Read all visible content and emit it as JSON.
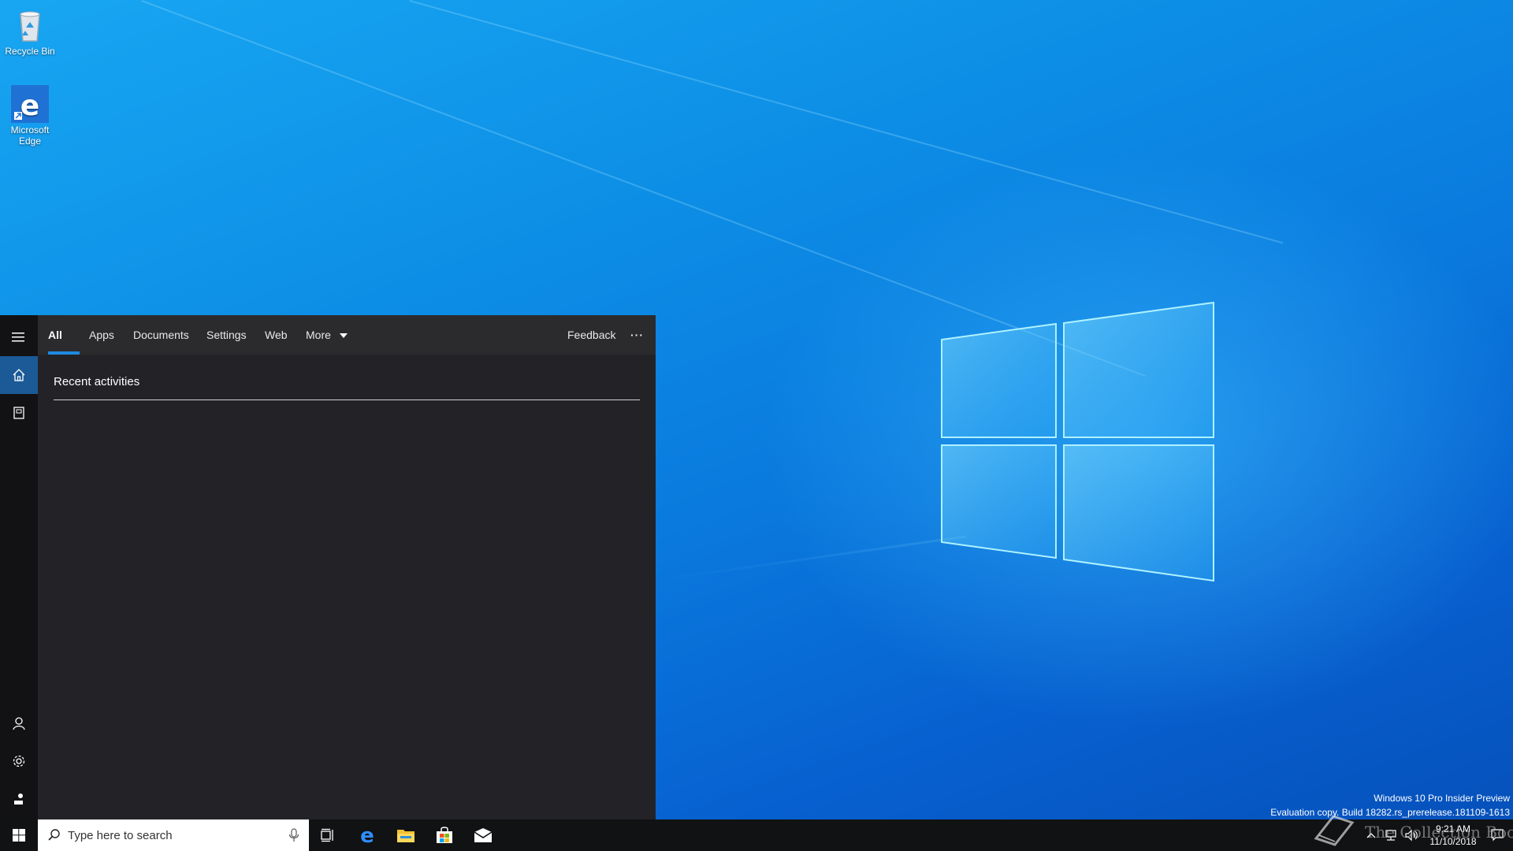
{
  "desktop": {
    "icons": [
      {
        "label": "Recycle Bin",
        "icon": "recycle-bin-icon"
      },
      {
        "label": "Microsoft Edge",
        "icon": "edge-icon"
      }
    ]
  },
  "search_panel": {
    "tabs": [
      {
        "label": "All",
        "active": true
      },
      {
        "label": "Apps"
      },
      {
        "label": "Documents"
      },
      {
        "label": "Settings"
      },
      {
        "label": "Web"
      },
      {
        "label": "More"
      }
    ],
    "feedback_label": "Feedback",
    "more_options_label": "···",
    "recent_heading": "Recent activities",
    "rail_icons": [
      "hamburger-icon",
      "home-icon",
      "notebook-icon",
      "account-icon",
      "settings-icon",
      "feedback-icon"
    ]
  },
  "taskbar": {
    "search_placeholder": "Type here to search",
    "pinned_icons": [
      "task-view-icon",
      "edge-icon",
      "file-explorer-icon",
      "store-icon",
      "mail-icon"
    ],
    "clock_time": "9:21 AM",
    "clock_date": "11/10/2018"
  },
  "watermark": {
    "line1": "Windows 10 Pro Insider Preview",
    "line2": "Evaluation copy. Build 18282.rs_prerelease.181109-1613"
  },
  "overlay_logo_text": "The Collection Book",
  "colors": {
    "accent": "#1e8ae0",
    "panel_bg": "#232327",
    "rail_bg": "#121214",
    "taskbar_bg": "#101214"
  }
}
